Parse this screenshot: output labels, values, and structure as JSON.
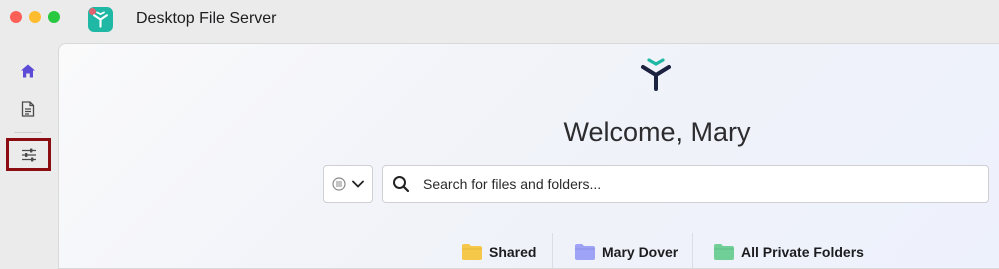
{
  "app": {
    "title": "Desktop File Server"
  },
  "main": {
    "welcome": "Welcome, Mary",
    "search": {
      "placeholder": "Search for files and folders...",
      "value": ""
    },
    "quick_links": [
      {
        "label": "Shared",
        "icon": "folder-yellow-icon",
        "color": "#f5c84a"
      },
      {
        "label": "Mary Dover",
        "icon": "folder-purple-icon",
        "color": "#9ea3f5"
      },
      {
        "label": "All Private Folders",
        "icon": "folder-green-icon",
        "color": "#6fcf97"
      }
    ]
  },
  "sidebar": {
    "items": [
      {
        "name": "home",
        "icon": "home-icon"
      },
      {
        "name": "documents",
        "icon": "document-icon"
      },
      {
        "name": "settings",
        "icon": "sliders-icon",
        "highlighted": true
      }
    ]
  },
  "colors": {
    "accent": "#5b4bd6",
    "app_icon": "#1fb8a5",
    "highlight_border": "#8b0d11"
  }
}
